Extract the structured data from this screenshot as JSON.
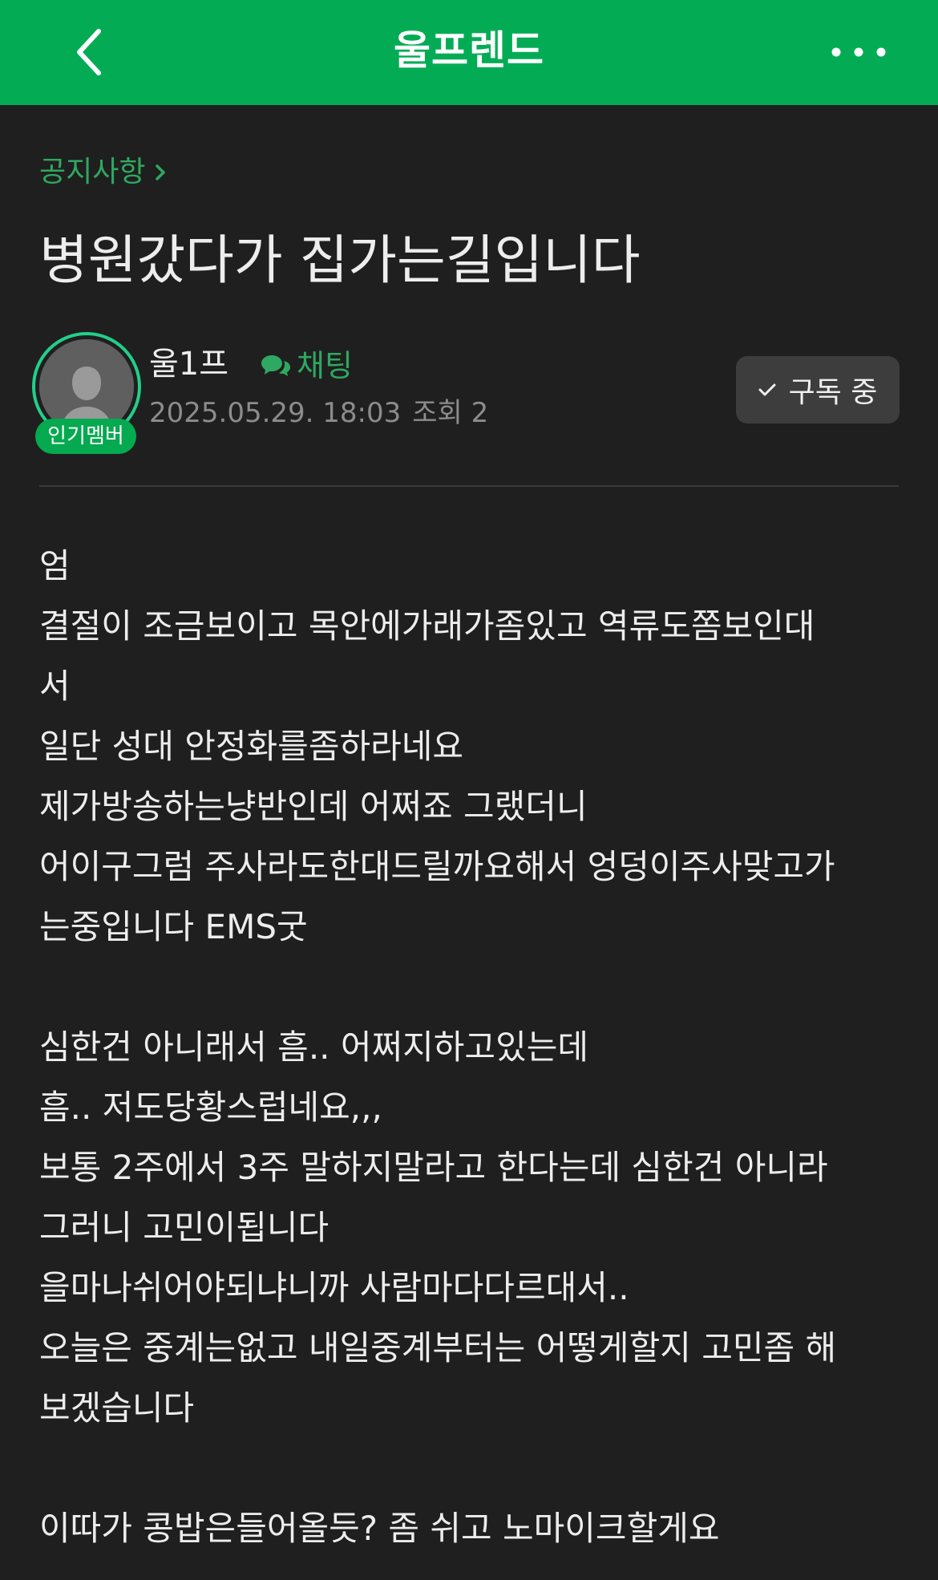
{
  "header": {
    "title": "울프렌드",
    "back_icon": "chevron-left-icon",
    "more_icon": "more-dots-icon",
    "background_color": "#03ac54"
  },
  "breadcrumb": {
    "label": "공지사항",
    "icon": "chevron-right-icon"
  },
  "post": {
    "title": "병원갔다가 집가는길입니다",
    "author": {
      "name": "울1프",
      "badge": "인기멤버",
      "avatar_icon": "default-avatar-icon"
    },
    "chat_label": "채팅",
    "date": "2025.05.29. 18:03",
    "views": "조회 2",
    "subscribe_label": "구독 중",
    "body_lines": [
      "엄",
      "결절이 조금보이고 목안에가래가좀있고 역류도쫌보인대",
      "서",
      "일단 성대 안정화를좀하라네요",
      "제가방송하는냥반인데 어쩌죠 그랬더니",
      "어이구그럼 주사라도한대드릴까요해서 엉덩이주사맞고가",
      "는중입니다 EMS굿",
      "",
      "심한건 아니래서 흠.. 어쩌지하고있는데",
      "흠.. 저도당황스럽네요,,,",
      "보통 2주에서 3주 말하지말라고 한다는데 심한건 아니라",
      "그러니 고민이됩니다",
      "을마나쉬어야되냐니까 사람마다다르대서..",
      "오늘은 중계는없고 내일중계부터는 어떻게할지 고민좀 해",
      "보겠습니다",
      "",
      "이따가 콩밥은들어올듯? 좀 쉬고 노마이크할게요"
    ]
  },
  "colors": {
    "accent_green": "#2fa861",
    "badge_green": "#05a94f",
    "background": "#1f1f1f"
  }
}
